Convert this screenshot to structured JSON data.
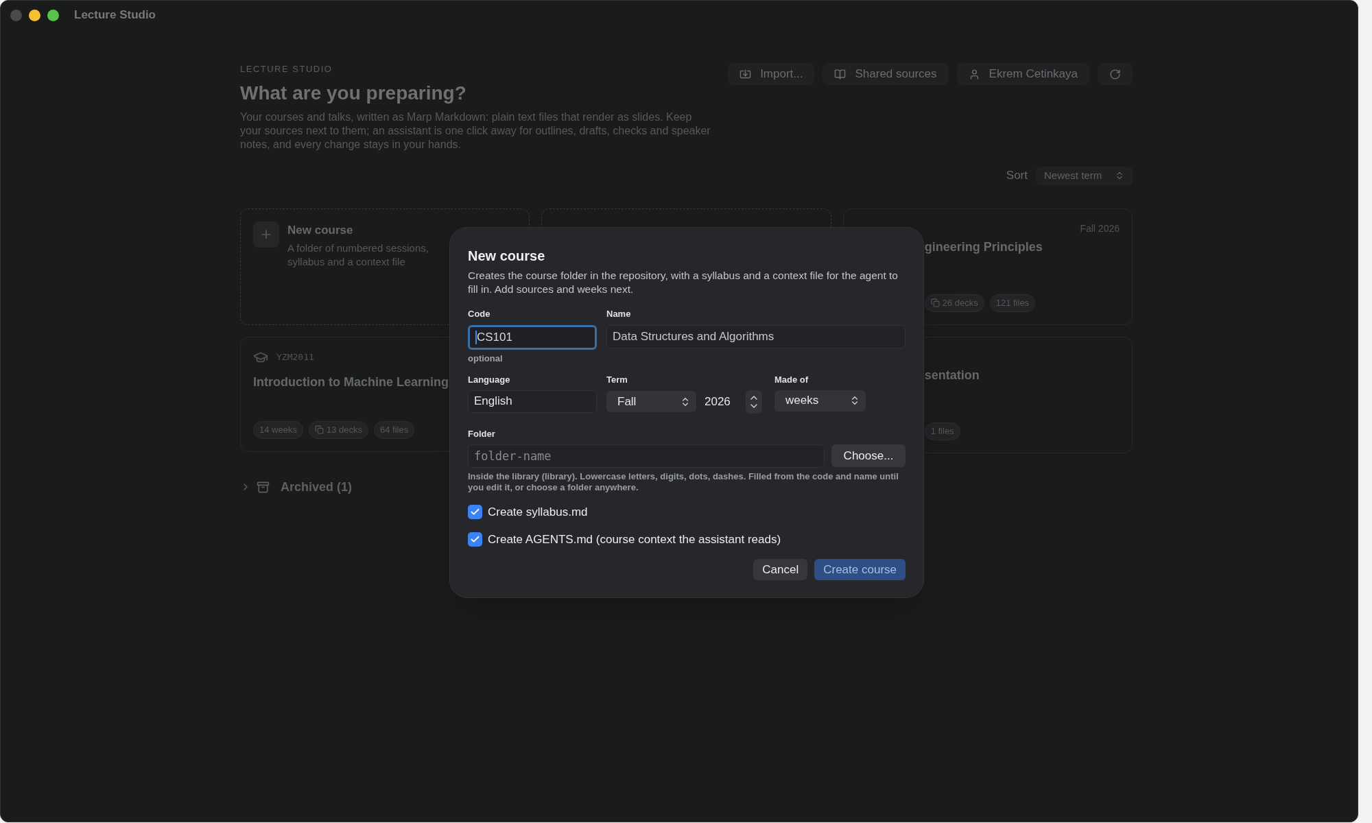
{
  "window": {
    "title": "Lecture Studio"
  },
  "header": {
    "eyebrow": "LECTURE STUDIO",
    "title": "What are you preparing?",
    "description": "Your courses and talks, written as Marp Markdown: plain text files that render as slides. Keep your sources next to them; an assistant is one click away for outlines, drafts, checks and speaker notes, and every change stays in your hands."
  },
  "toolbar": [
    {
      "kind": "import",
      "label": "Import..."
    },
    {
      "kind": "sources",
      "label": "Shared sources"
    },
    {
      "kind": "user",
      "label": "Ekrem Cetinkaya"
    },
    {
      "kind": "refresh"
    }
  ],
  "sort": {
    "label": "Sort",
    "value": "Newest term"
  },
  "cards": [
    {
      "kind": "new",
      "title": "New course",
      "description": "A folder of numbered sessions, syllabus and a context file"
    },
    {
      "kind": "new_hidden"
    },
    {
      "kind": "course_partial",
      "term": "Fall 2026",
      "title": "gineering Principles",
      "chips": [
        {
          "label": "26 decks",
          "icon": true
        },
        {
          "label": "121 files",
          "icon": false
        }
      ]
    },
    {
      "kind": "course",
      "code": "YZM2011",
      "title": "Introduction to Machine Learning",
      "chips": [
        {
          "label": "14 weeks",
          "icon": false
        },
        {
          "label": "13 decks",
          "icon": true
        },
        {
          "label": "64 files",
          "icon": false
        }
      ]
    },
    {
      "kind": "course_partial",
      "title": "sentation",
      "chips": [
        {
          "label": "1 files",
          "icon": false
        }
      ]
    }
  ],
  "archived": {
    "label": "Archived (1)",
    "expanded": false
  },
  "dialog": {
    "title": "New course",
    "description": "Creates the course folder in the repository, with a syllabus and a context file for the agent to fill in. Add sources and weeks next.",
    "code": {
      "label": "Code",
      "value": "CS101",
      "hint": "optional",
      "focused": true
    },
    "name": {
      "label": "Name",
      "value": "Data Structures and Algorithms"
    },
    "language": {
      "label": "Language",
      "value": "English"
    },
    "term": {
      "label": "Term",
      "season": "Fall",
      "year": "2026"
    },
    "made_of": {
      "label": "Made of",
      "value": "weeks"
    },
    "folder": {
      "label": "Folder",
      "placeholder": "folder-name",
      "button": "Choose...",
      "hint": "Inside the library (library). Lowercase letters, digits, dots, dashes. Filled from the code and name until you edit it, or choose a folder anywhere."
    },
    "options": [
      {
        "label": "Create syllabus.md",
        "checked": true
      },
      {
        "label": "Create AGENTS.md (course context the assistant reads)",
        "checked": true
      }
    ],
    "buttons": [
      {
        "label": "Cancel",
        "primary": false
      },
      {
        "label": "Create course",
        "primary": true
      }
    ]
  }
}
